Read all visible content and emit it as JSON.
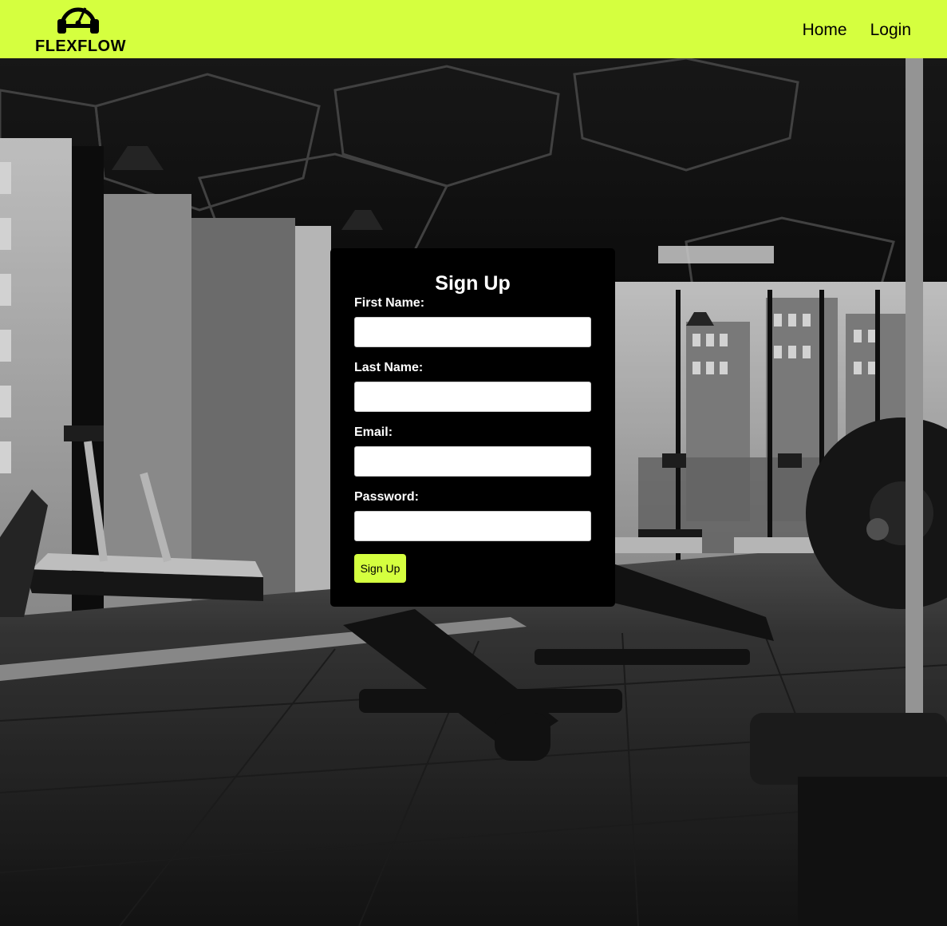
{
  "brand": {
    "name": "FLEXFLOW",
    "logo_icon": "headphones-gauge-icon",
    "accent_color": "#d5ff3f"
  },
  "nav": {
    "items": [
      {
        "label": "Home"
      },
      {
        "label": "Login"
      }
    ]
  },
  "hero": {
    "image": "gym-interior-photo"
  },
  "signup": {
    "title": "Sign Up",
    "fields": [
      {
        "label": "First Name:",
        "value": "",
        "placeholder": ""
      },
      {
        "label": "Last Name:",
        "value": "",
        "placeholder": ""
      },
      {
        "label": "Email:",
        "value": "",
        "placeholder": ""
      },
      {
        "label": "Password:",
        "value": "",
        "placeholder": ""
      }
    ],
    "submit_label": "Sign Up"
  }
}
